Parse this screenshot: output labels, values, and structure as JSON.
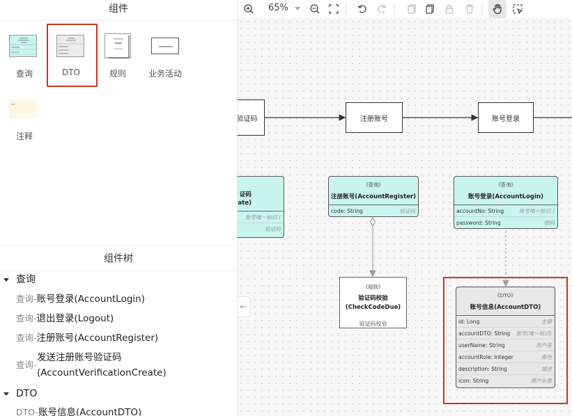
{
  "components_panel": {
    "title": "组件",
    "items": [
      {
        "label": "查询",
        "thumb_title": "《查询》",
        "icon": "query-thumbnail"
      },
      {
        "label": "DTO",
        "thumb_title": "《DTO》",
        "icon": "dto-thumbnail",
        "selected": true
      },
      {
        "label": "规则",
        "thumb_title": "《规则》",
        "icon": "rule-thumbnail"
      },
      {
        "label": "业务活动",
        "thumb_title": "业务活动",
        "icon": "activity-thumbnail"
      },
      {
        "label": "注释",
        "thumb_title": "注释",
        "icon": "note-thumbnail"
      }
    ]
  },
  "tree": {
    "title": "组件树",
    "groups": [
      {
        "label": "查询",
        "items": [
          {
            "prefix": "查询-",
            "text": "账号登录(AccountLogin)"
          },
          {
            "prefix": "查询-",
            "text": "退出登录(Logout)"
          },
          {
            "prefix": "查询-",
            "text": "注册账号(AccountRegister)"
          },
          {
            "prefix": "查询-",
            "text": "发送注册账号验证码",
            "text2": "(AccountVerificationCreate)"
          }
        ]
      },
      {
        "label": "DTO",
        "items": [
          {
            "prefix": "DTO-",
            "text": "账号信息(AccountDTO)"
          }
        ]
      }
    ]
  },
  "toolbar": {
    "zoom_value": "65%",
    "icons": [
      "zoom-in-icon",
      "zoom-out-icon",
      "fit-screen-icon",
      "undo-icon",
      "redo-icon",
      "copy-icon",
      "paste-icon",
      "lock-icon",
      "delete-icon",
      "hand-icon",
      "select-icon"
    ]
  },
  "canvas": {
    "process_nodes": [
      "验证码",
      "注册账号",
      "账号登录"
    ],
    "query_cards": [
      {
        "stereotype": "",
        "name_line1": "证码",
        "name_line2": "onCreate)",
        "rows": [
          {
            "field": "",
            "comment": "账号唯一标识 ("
          },
          {
            "field": "",
            "comment": "验证码"
          }
        ]
      },
      {
        "stereotype": "《查询》",
        "name": "注册账号(AccountRegister)",
        "rows": [
          {
            "field": "code: String",
            "comment": "验证码"
          }
        ]
      },
      {
        "stereotype": "《查询》",
        "name": "账号登录(AccountLogin)",
        "rows": [
          {
            "field": "accountNo: String",
            "comment": "账号唯一标识 ("
          },
          {
            "field": "password: String",
            "comment": "密码"
          }
        ]
      }
    ],
    "rule_card": {
      "stereotype": "《规则》",
      "name_line1": "验证码校验",
      "name_line2": "(CheckCodeDue)",
      "footer": "验证码校验"
    },
    "dto_card": {
      "stereotype": "《DTO》",
      "name": "账号信息(AccountDTO)",
      "rows": [
        {
          "field": "id: Long",
          "comment": "主键"
        },
        {
          "field": "accountDTO: String",
          "comment": "账号(唯一标识)"
        },
        {
          "field": "userName: String",
          "comment": "用户名"
        },
        {
          "field": "accountRole: Integer",
          "comment": "角色"
        },
        {
          "field": "description: String",
          "comment": "描述"
        },
        {
          "field": "icon: String",
          "comment": "用户头像"
        }
      ]
    },
    "colors": {
      "query_fill": "#c9f5ef",
      "dto_fill": "#e8e8e8",
      "highlight": "#d0321e"
    }
  }
}
